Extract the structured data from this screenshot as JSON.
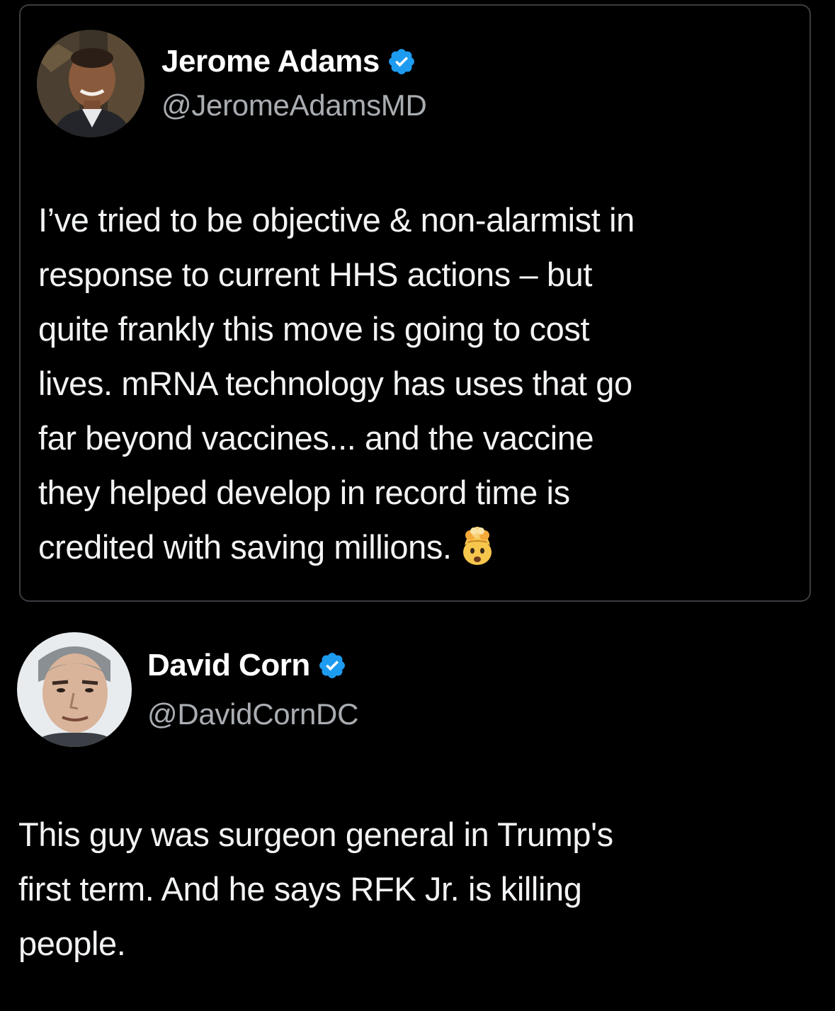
{
  "quoted_tweet": {
    "author_name": "Jerome Adams",
    "author_handle": "@JeromeAdamsMD",
    "verified": true,
    "text": "I’ve tried to be objective & non-alarmist in\nresponse to current HHS actions – but\nquite frankly this move is going to cost\nlives. mRNA technology has uses that go\nfar beyond vaccines... and the vaccine\nthey helped develop in record time is\ncredited with saving millions.",
    "trailing_emoji": "exploding-head-icon"
  },
  "main_tweet": {
    "author_name": "David Corn",
    "author_handle": "@DavidCornDC",
    "verified": true,
    "text": "This guy was surgeon general in Trump's\nfirst term. And he says RFK Jr. is killing\npeople."
  },
  "colors": {
    "background": "#000000",
    "verified_badge": "#1d9bf0",
    "handle_text": "#a9adb2",
    "border": "#3a3d41"
  }
}
